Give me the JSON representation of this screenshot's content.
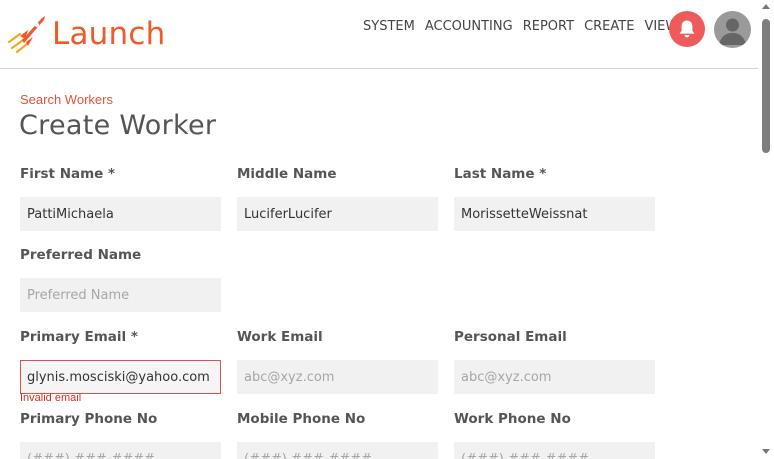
{
  "app": {
    "name": "Launch"
  },
  "colors": {
    "brand": "#ef5a2a",
    "error": "#d0311c",
    "input_bg": "#f1f1f1",
    "bell_bg": "#ef5a5a"
  },
  "nav": {
    "items": [
      "SYSTEM",
      "ACCOUNTING",
      "REPORT",
      "CREATE",
      "VIEW"
    ]
  },
  "icons": {
    "notifications": "bell-icon",
    "user": "avatar-icon",
    "logo": "rocket-icon"
  },
  "breadcrumb": "Search Workers",
  "page_title": "Create Worker",
  "form": {
    "first_name": {
      "label": "First Name *",
      "value": "PattiMichaela",
      "placeholder": ""
    },
    "middle_name": {
      "label": "Middle Name",
      "value": "LuciferLucifer",
      "placeholder": ""
    },
    "last_name": {
      "label": "Last Name *",
      "value": "MorissetteWeissnat",
      "placeholder": ""
    },
    "preferred_name": {
      "label": "Preferred Name",
      "value": "",
      "placeholder": "Preferred Name"
    },
    "primary_email": {
      "label": "Primary Email *",
      "value": "glynis.mosciski@yahoo.com",
      "placeholder": "",
      "error": "Invalid email"
    },
    "work_email": {
      "label": "Work Email",
      "value": "",
      "placeholder": "abc@xyz.com"
    },
    "personal_email": {
      "label": "Personal Email",
      "value": "",
      "placeholder": "abc@xyz.com"
    },
    "primary_phone": {
      "label": "Primary Phone No",
      "value": "",
      "placeholder": "(###) ###-####"
    },
    "mobile_phone": {
      "label": "Mobile Phone No",
      "value": "",
      "placeholder": "(###) ###-####"
    },
    "work_phone": {
      "label": "Work Phone No",
      "value": "",
      "placeholder": "(###) ###-####"
    }
  }
}
